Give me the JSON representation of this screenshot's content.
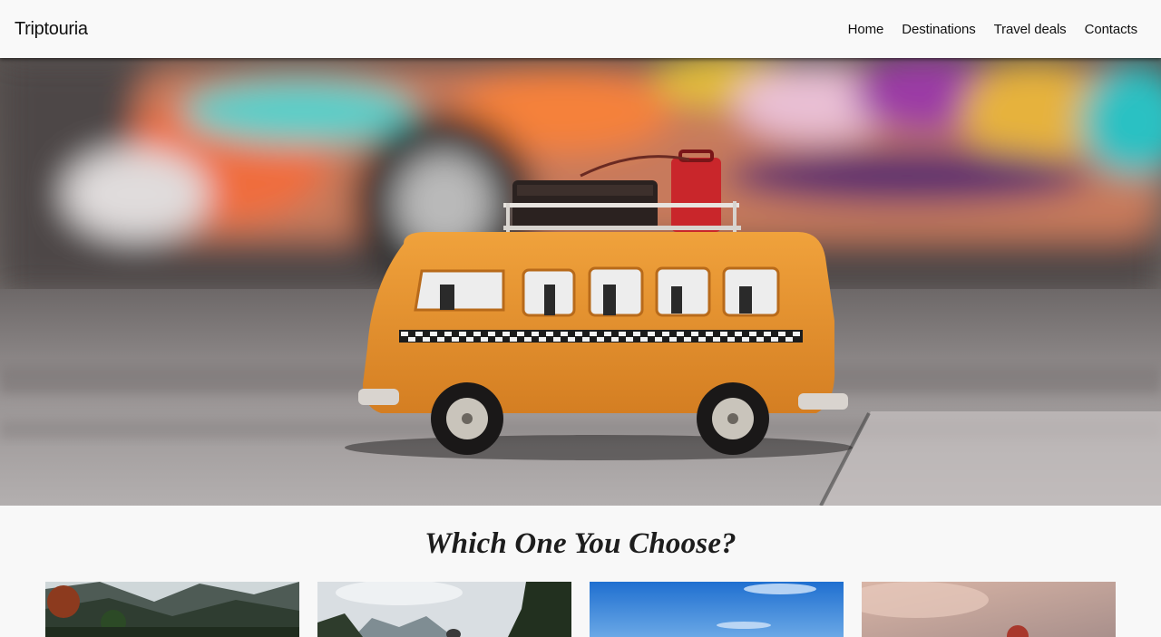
{
  "navbar": {
    "brand": "Triptouria",
    "links": [
      {
        "label": "Home"
      },
      {
        "label": "Destinations"
      },
      {
        "label": "Travel deals"
      },
      {
        "label": "Contacts"
      }
    ]
  },
  "hero": {
    "image_icon": "toy-van-photo",
    "colors": {
      "van": "#e8952f",
      "suitcase": "#c9262b",
      "ground": "#8f8b8b"
    }
  },
  "section": {
    "title": "Which One You Choose?"
  },
  "cards": [
    {
      "image_icon": "mountain-valley-photo"
    },
    {
      "image_icon": "lake-forest-photo"
    },
    {
      "image_icon": "blue-sky-photo"
    },
    {
      "image_icon": "sunset-person-photo"
    }
  ]
}
